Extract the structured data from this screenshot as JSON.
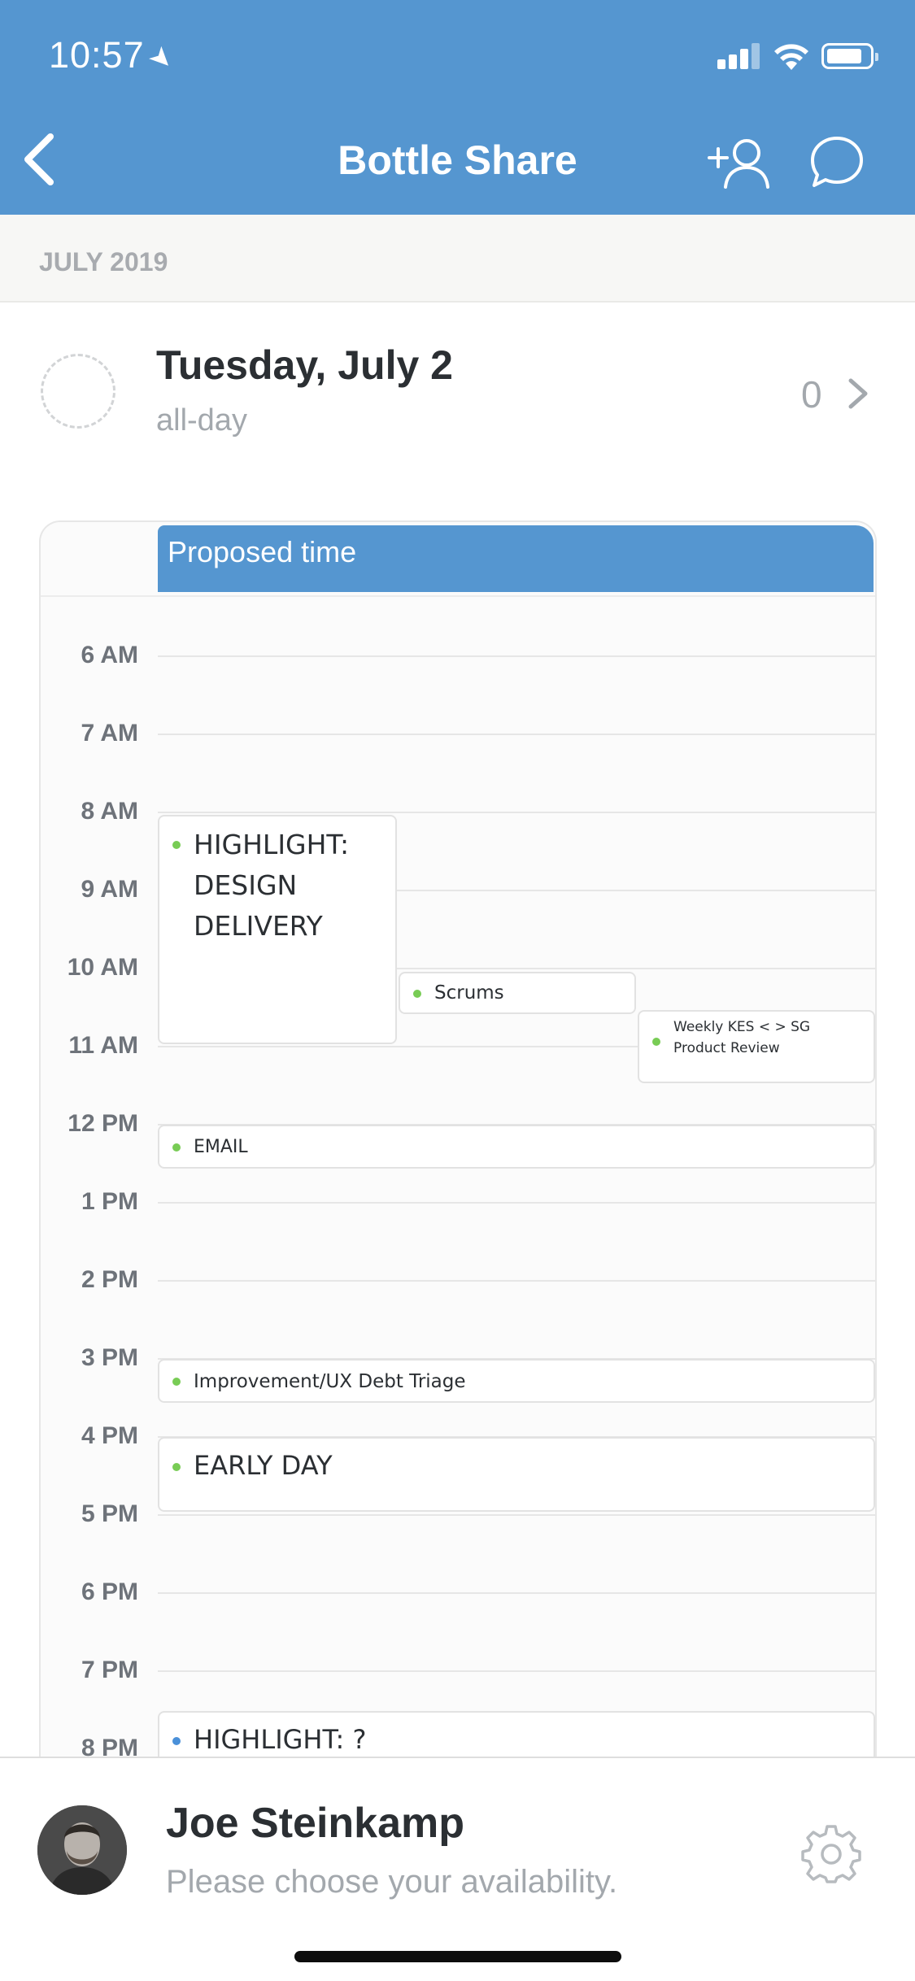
{
  "status_bar": {
    "time": "10:57"
  },
  "header": {
    "title": "Bottle Share"
  },
  "month_label": "JULY 2019",
  "date_row": {
    "title": "Tuesday, July 2",
    "subtitle": "all-day",
    "count": "0"
  },
  "calendar": {
    "proposed_label": "Proposed time",
    "hours": [
      "6 AM",
      "7 AM",
      "8 AM",
      "9 AM",
      "10 AM",
      "11 AM",
      "12 PM",
      "1 PM",
      "2 PM",
      "3 PM",
      "4 PM",
      "5 PM",
      "6 PM",
      "7 PM",
      "8 PM"
    ],
    "events": [
      {
        "title": "HIGHLIGHT: DESIGN DELIVERY",
        "dot_color": "#78cc55"
      },
      {
        "title": "Scrums",
        "dot_color": "#78cc55"
      },
      {
        "title": "Weekly KES < > SG Product Review",
        "dot_color": "#78cc55"
      },
      {
        "title": "EMAIL",
        "dot_color": "#78cc55"
      },
      {
        "title": "Improvement/UX Debt Triage",
        "dot_color": "#78cc55"
      },
      {
        "title": "EARLY DAY",
        "dot_color": "#78cc55"
      },
      {
        "title": "HIGHLIGHT: ?",
        "dot_color": "#4a90d9"
      }
    ]
  },
  "bottom_panel": {
    "name": "Joe Steinkamp",
    "subtitle": "Please choose your availability."
  },
  "colors": {
    "accent": "#5596d0",
    "event_dot_green": "#78cc55",
    "event_dot_blue": "#4a90d9"
  }
}
